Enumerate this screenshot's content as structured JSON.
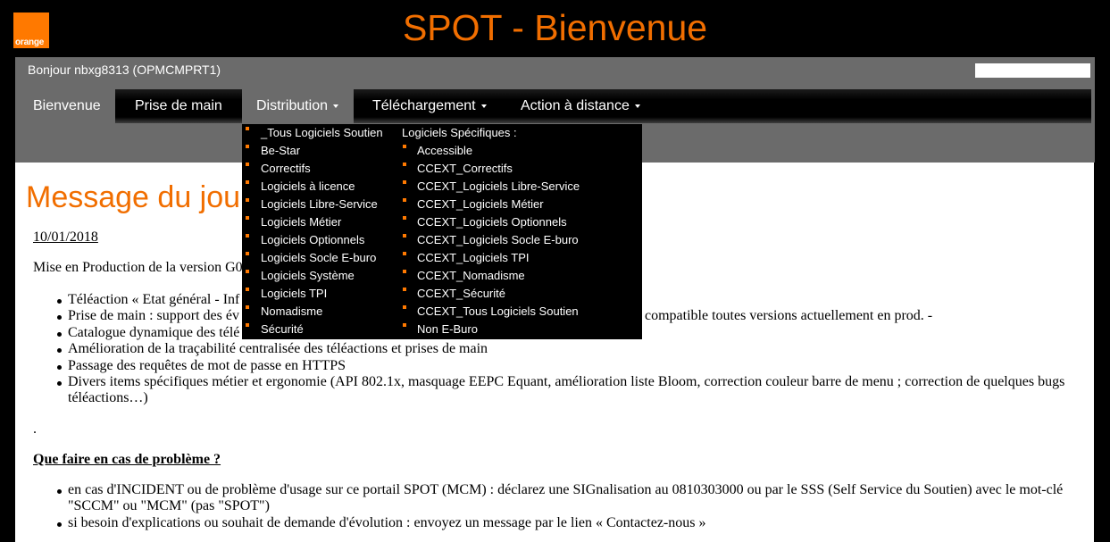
{
  "colors": {
    "accent": "#f16e00",
    "brand": "#ff7900"
  },
  "header": {
    "logo_text": "orange",
    "title": "SPOT - Bienvenue"
  },
  "userbar": {
    "greeting": "Bonjour nbxg8313 (OPMCMPRT1)",
    "search": {
      "value": "",
      "placeholder": ""
    }
  },
  "nav": {
    "menu_icon": "chevron-down-icon",
    "items": [
      {
        "label": "Bienvenue",
        "active": true,
        "has_menu": false
      },
      {
        "label": "Prise de main",
        "active": false,
        "has_menu": false
      },
      {
        "label": "Distribution",
        "active": false,
        "has_menu": true,
        "expanded": true
      },
      {
        "label": "Téléchargement",
        "active": false,
        "has_menu": true
      },
      {
        "label": "Action à distance",
        "active": false,
        "has_menu": true
      }
    ]
  },
  "distribution_menu": {
    "bullet_icon": "square-bullet-icon",
    "general_items": [
      "_Tous Logiciels Soutien",
      "Be-Star",
      "Correctifs",
      "Logiciels à licence",
      "Logiciels Libre-Service",
      "Logiciels Métier",
      "Logiciels Optionnels",
      "Logiciels Socle E-buro",
      "Logiciels Système",
      "Logiciels TPI",
      "Nomadisme",
      "Sécurité"
    ],
    "specific_header": "Logiciels Spécifiques :",
    "specific_items": [
      "Accessible",
      "CCEXT_Correctifs",
      "CCEXT_Logiciels Libre-Service",
      "CCEXT_Logiciels Métier",
      "CCEXT_Logiciels Optionnels",
      "CCEXT_Logiciels Socle E-buro",
      "CCEXT_Logiciels TPI",
      "CCEXT_Nomadisme",
      "CCEXT_Sécurité",
      "CCEXT_Tous Logiciels Soutien",
      "Non E-Buro"
    ]
  },
  "content": {
    "title": "Message du jou",
    "date": "10/01/2018",
    "intro": "Mise en Production de la version G0",
    "changes": [
      {
        "text": "Téléaction « Etat général - Inf"
      },
      {
        "text": "Prise de main : support des év",
        "tail": "compatible toutes versions actuellement en prod. -"
      },
      {
        "text": "Catalogue dynamique des télé"
      },
      {
        "text": "Amélioration de la traçabilité centralisée des téléactions et prises de main"
      },
      {
        "text": "Passage des requêtes de mot de passe en HTTPS"
      },
      {
        "text": "Divers items spécifiques métier et ergonomie (API 802.1x, masquage EEPC Equant, amélioration liste Bloom, correction couleur barre de menu ; correction de quelques bugs téléactions…)"
      }
    ],
    "separator": ".",
    "problem": {
      "heading": "Que faire en cas de problème ?",
      "items": [
        "en cas d'INCIDENT ou de problème d'usage sur ce portail SPOT (MCM) : déclarez une SIGnalisation au 0810303000 ou par le SSS (Self Service du Soutien) avec le mot-clé \"SCCM\" ou \"MCM\" (pas \"SPOT\")",
        "si besoin d'explications ou souhait de demande d'évolution : envoyez un message par le lien « Contactez-nous »"
      ]
    }
  }
}
